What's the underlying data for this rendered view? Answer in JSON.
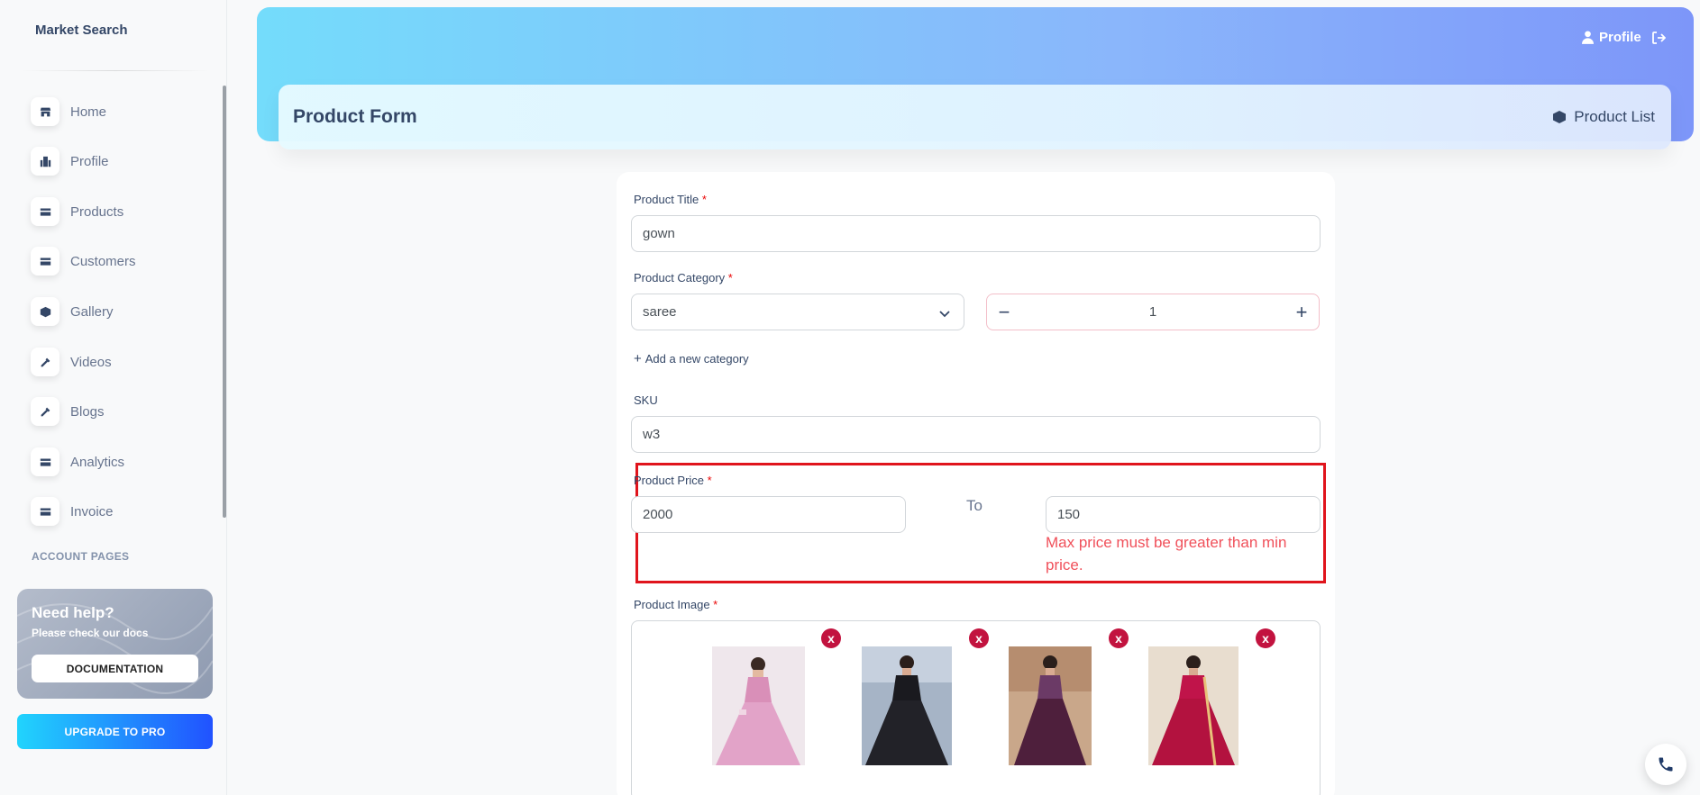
{
  "brand": {
    "name": "Market Search"
  },
  "sidebar": {
    "items": [
      {
        "label": "Home",
        "icon": "shop-icon"
      },
      {
        "label": "Profile",
        "icon": "office-icon"
      },
      {
        "label": "Products",
        "icon": "credit-card-icon"
      },
      {
        "label": "Customers",
        "icon": "credit-card-icon"
      },
      {
        "label": "Gallery",
        "icon": "box-3d-icon"
      },
      {
        "label": "Videos",
        "icon": "settings-tools-icon"
      },
      {
        "label": "Blogs",
        "icon": "settings-tools-icon"
      },
      {
        "label": "Analytics",
        "icon": "credit-card-icon"
      },
      {
        "label": "Invoice",
        "icon": "credit-card-icon"
      }
    ],
    "section_title": "ACCOUNT PAGES",
    "help": {
      "title": "Need help?",
      "subtitle": "Please check our docs",
      "button": "DOCUMENTATION"
    },
    "upgrade": "UPGRADE TO PRO"
  },
  "header": {
    "profile_label": "Profile",
    "page_title": "Product Form",
    "product_list_label": "Product List"
  },
  "form": {
    "title_label": "Product Title",
    "title_value": "gown",
    "category_label": "Product Category",
    "category_value": "saree",
    "quantity_value": "1",
    "add_category": "Add a new category",
    "sku_label": "SKU",
    "sku_value": "w3",
    "price_label": "Product Price",
    "min_price": "2000",
    "to_label": "To",
    "max_price": "150",
    "price_error": "Max price must be greater than min price.",
    "image_label": "Product Image",
    "required_mark": "*",
    "remove_label": "x",
    "images": [
      "pink-gown",
      "black-gown",
      "wine-gown",
      "red-gown"
    ]
  },
  "colors": {
    "accent": "#cb0c9f",
    "error": "#f0505a",
    "highlight": "#e0141c"
  }
}
